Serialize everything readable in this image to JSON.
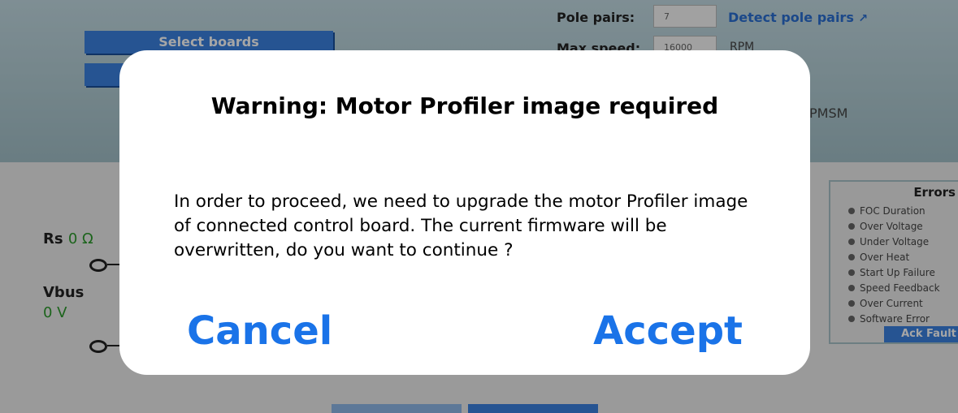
{
  "background": {
    "select_boards": "Select boards",
    "pole_pairs_label": "Pole pairs:",
    "pole_pairs_value": "7",
    "detect_pole_pairs": "Detect pole pairs",
    "max_speed_label": "Max speed:",
    "max_speed_value": "16000",
    "max_speed_unit": "RPM",
    "motor_type_fragment": "PMSM",
    "rs_label": "Rs",
    "rs_value": "0 Ω",
    "vbus_label": "Vbus",
    "vbus_value": "0 V",
    "errors": {
      "title": "Errors",
      "items": [
        "FOC Duration",
        "Over Voltage",
        "Under Voltage",
        "Over Heat",
        "Start Up Failure",
        "Speed Feedback",
        "Over Current",
        "Software Error"
      ],
      "ack_label": "Ack Fault"
    }
  },
  "dialog": {
    "title": "Warning: Motor Profiler image required",
    "body": "In order to proceed, we need to upgrade the motor Profiler image of connected control board. The current firmware will be overwritten, do you want to continue ?",
    "cancel_label": "Cancel",
    "accept_label": "Accept"
  },
  "colors": {
    "accent": "#1a73e8",
    "bg_button_blue": "#3b82e0",
    "value_green": "#2c9a2c"
  }
}
